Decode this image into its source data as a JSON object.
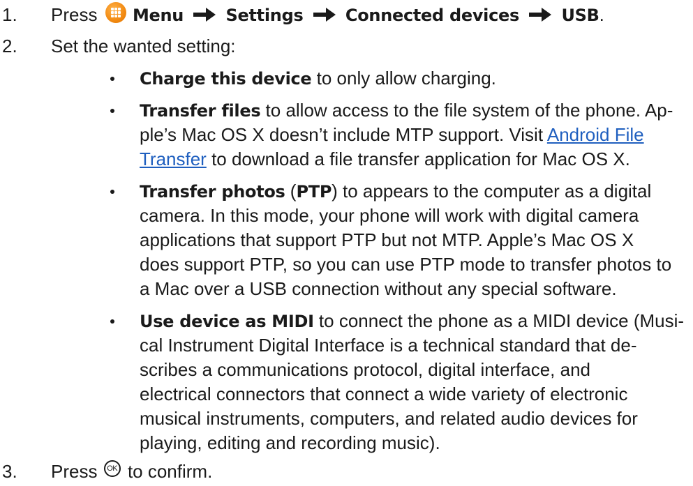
{
  "steps": {
    "s1": {
      "number": "1.",
      "press": "Press",
      "menu": "Menu",
      "settings": "Settings",
      "connected": "Connected devices",
      "usb": "USB",
      "end": "."
    },
    "s2": {
      "number": "2.",
      "text": "Set the wanted setting:"
    },
    "s3": {
      "number": "3.",
      "press": "Press",
      "ok": "OK",
      "end": "to confirm."
    }
  },
  "bullets": {
    "charge": {
      "term": "Charge this device",
      "l1": " to only allow charging."
    },
    "transfer_files": {
      "term": "Transfer files",
      "l1": " to allow access to the file system of the phone. Ap-",
      "l2": "ple’s Mac OS X doesn’t include MTP support. Visit ",
      "link_a": "Android File",
      "link_b": "Transfer",
      "l3": " to download a file transfer application for Mac OS X."
    },
    "transfer_photos": {
      "term": "Transfer photos",
      "paren_open": " (",
      "ptp": "PTP",
      "paren_close": ")",
      "l1": " to appears to the computer as a digital",
      "l2": "camera. In this mode, your phone will work with digital camera",
      "l3": "applications that support PTP but not MTP. Apple’s Mac OS X",
      "l4": "does support PTP, so you can use PTP mode to transfer photos to",
      "l5": "a Mac over a USB connection without any special software."
    },
    "midi": {
      "term": "Use device as MIDI",
      "l1": " to connect the phone as a MIDI device (Musi-",
      "l2": "cal Instrument Digital Interface is a technical standard that de-",
      "l3": "scribes a communications protocol, digital interface, and",
      "l4": "electrical connectors that connect a wide variety of electronic",
      "l5": "musical instruments, computers, and related audio devices for",
      "l6": "playing, editing and recording music)."
    }
  },
  "colors": {
    "text": "#1a1a1a",
    "link": "#1f5fbf",
    "menu_icon": "#f28a12"
  },
  "icons": {
    "menu": "menu-grid-icon",
    "arrow": "right-arrow-icon",
    "ok": "ok-circle-icon"
  }
}
